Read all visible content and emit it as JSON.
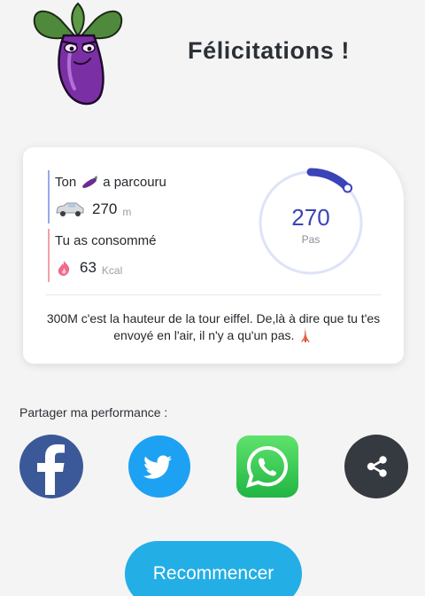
{
  "header": {
    "title": "Félicitations !"
  },
  "stats": {
    "distance": {
      "label_prefix": "Ton",
      "label_suffix": "a parcouru",
      "value": "270",
      "unit": "m"
    },
    "energy": {
      "label": "Tu as consommé",
      "value": "63",
      "unit": "Kcal"
    },
    "steps": {
      "value": "270",
      "unit": "Pas",
      "progress_fraction": 0.13
    },
    "fact_text": "300M c'est la hauteur de la tour eiffel. De,là à dire que tu t'es envoyé en l'air, il n'y a qu'un pas. 🗼"
  },
  "share": {
    "label": "Partager ma performance :",
    "buttons": [
      {
        "name": "facebook",
        "icon": "facebook-icon",
        "color": "#3b5998"
      },
      {
        "name": "twitter",
        "icon": "twitter-icon",
        "color": "#1da1f2"
      },
      {
        "name": "whatsapp",
        "icon": "whatsapp-icon",
        "color": "#2ac64b"
      },
      {
        "name": "share",
        "icon": "share-icon",
        "color": "#353a40"
      }
    ]
  },
  "actions": {
    "restart_label": "Recommencer"
  },
  "colors": {
    "accent": "#3a43b8",
    "restart_button": "#23aee6",
    "background": "#f4f4f5"
  }
}
